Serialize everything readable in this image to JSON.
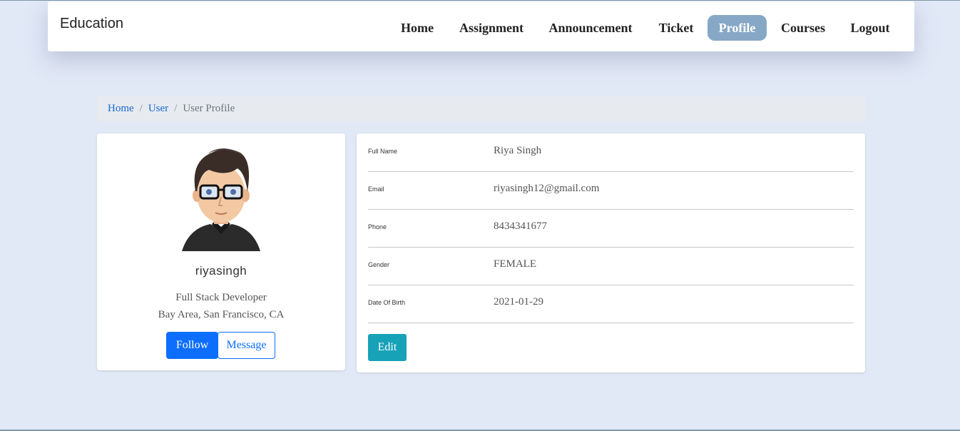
{
  "navbar": {
    "brand": "Education",
    "links": [
      "Home",
      "Assignment",
      "Announcement",
      "Ticket",
      "Profile",
      "Courses",
      "Logout"
    ],
    "active": "Profile"
  },
  "breadcrumb": {
    "items": [
      "Home",
      "User"
    ],
    "current": "User Profile"
  },
  "profile": {
    "avatar_icon": "avatar-illustration",
    "username": "riyasingh",
    "role": "Full Stack Developer",
    "location": "Bay Area, San Francisco, CA",
    "follow_label": "Follow",
    "message_label": "Message"
  },
  "details": {
    "rows": [
      {
        "label": "Full Name",
        "value": "Riya Singh"
      },
      {
        "label": "Email",
        "value": "riyasingh12@gmail.com"
      },
      {
        "label": "Phone",
        "value": "8434341677"
      },
      {
        "label": "Gender",
        "value": "FEMALE"
      },
      {
        "label": "Date Of Birth",
        "value": "2021-01-29"
      }
    ],
    "edit_label": "Edit"
  },
  "colors": {
    "page_bg": "#e1e8f6",
    "active_nav": "#87a7c6",
    "primary": "#0d6efd",
    "edit": "#17a2b8"
  }
}
